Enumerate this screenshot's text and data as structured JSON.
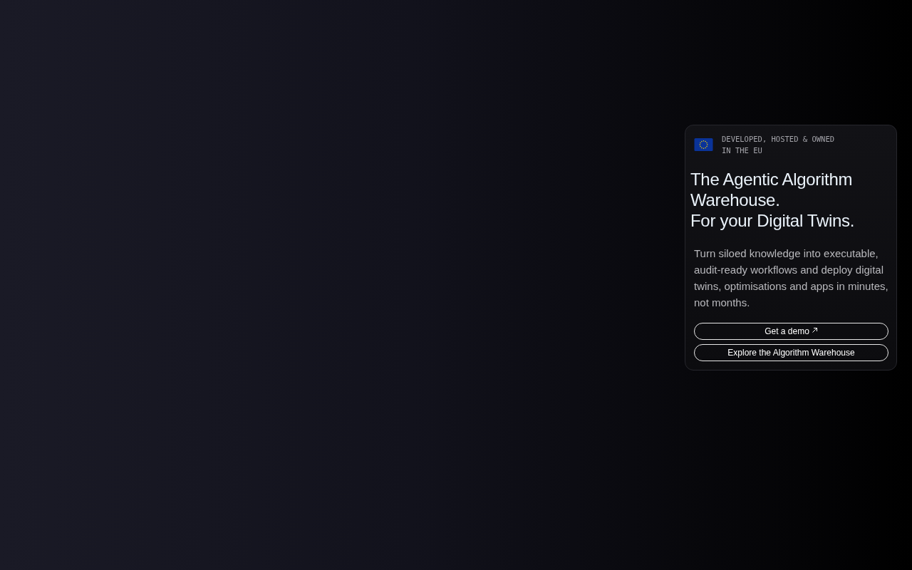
{
  "badge": {
    "lines": [
      "DEVELOPED, HOSTED & OWNED",
      "IN THE EU"
    ]
  },
  "headline": [
    "The Agentic Algorithm",
    "Warehouse.",
    "For your Digital Twins."
  ],
  "description": "Turn siloed knowledge into executable, audit-ready workflows and deploy digital twins, optimisations and apps in minutes, not months.",
  "buttons": [
    {
      "label": "Get a demo",
      "external": true
    },
    {
      "label": "Explore the Algorithm Warehouse",
      "external": false
    }
  ]
}
